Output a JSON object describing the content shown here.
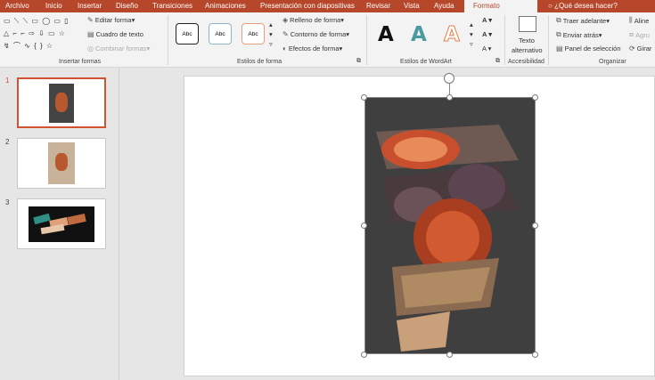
{
  "tabs": [
    {
      "label": "Archivo"
    },
    {
      "label": "Inicio"
    },
    {
      "label": "Insertar"
    },
    {
      "label": "Diseño"
    },
    {
      "label": "Transiciones"
    },
    {
      "label": "Animaciones"
    },
    {
      "label": "Presentación con diapositivas"
    },
    {
      "label": "Revisar"
    },
    {
      "label": "Vista"
    },
    {
      "label": "Ayuda"
    },
    {
      "label": "Formato"
    }
  ],
  "tell_me": "¿Qué desea hacer?",
  "ribbon": {
    "insert_shapes": {
      "label": "Insertar formas",
      "edit_shape": "Editar forma",
      "text_box": "Cuadro de texto",
      "merge_shapes": "Combinar formas"
    },
    "shape_styles": {
      "label": "Estilos de forma",
      "swatch_text": "Abc",
      "fill": "Relleno de forma",
      "outline": "Contorno de forma",
      "effects": "Efectos de forma"
    },
    "wordart_styles": {
      "label": "Estilos de WordArt",
      "sample": "A"
    },
    "accessibility": {
      "label": "Accesibilidad",
      "alt_text_1": "Texto",
      "alt_text_2": "alternativo"
    },
    "arrange": {
      "label": "Organizar",
      "bring_forward": "Traer adelante",
      "send_backward": "Enviar atrás",
      "selection_pane": "Panel de selección",
      "align": "Aline",
      "group": "Agru",
      "rotate": "Girar"
    }
  },
  "slides": [
    {
      "number": "1"
    },
    {
      "number": "2"
    },
    {
      "number": "3"
    }
  ],
  "colors": {
    "accent": "#b7472a",
    "selection": "#d35230",
    "wordart_black": "#111111",
    "wordart_teal": "#4a9aa0",
    "wordart_orange": "#e67d4a"
  }
}
